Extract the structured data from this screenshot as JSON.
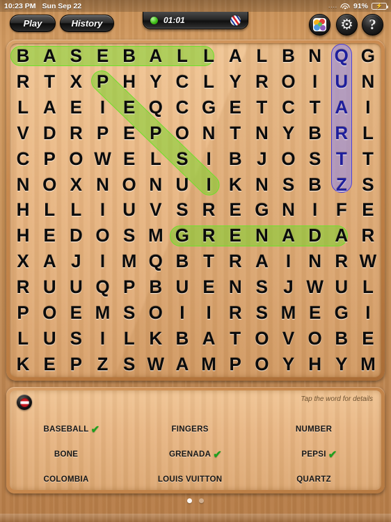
{
  "status_bar": {
    "time": "10:23 PM",
    "date": "Sun Sep 22",
    "signal_dots": "....",
    "wifi_icon": "wifi-icon",
    "battery_percent": "91%",
    "battery_icon": "battery-charging-icon"
  },
  "toolbar": {
    "play_label": "Play",
    "history_label": "History",
    "timer": "01:01",
    "timer_status_icon": "green-dot-icon",
    "timer_right_icon": "candy-stripe-icon",
    "gamecenter_icon": "game-center-icon",
    "settings_icon": "gear-icon",
    "help_icon": "question-mark-icon"
  },
  "grid": {
    "rows": 13,
    "cols": 14,
    "letters": [
      [
        "B",
        "A",
        "S",
        "E",
        "B",
        "A",
        "L",
        "L",
        "A",
        "L",
        "B",
        "N",
        "Q",
        "G"
      ],
      [
        "R",
        "T",
        "X",
        "P",
        "H",
        "Y",
        "C",
        "L",
        "Y",
        "R",
        "O",
        "I",
        "U",
        "N"
      ],
      [
        "L",
        "A",
        "E",
        "I",
        "E",
        "Q",
        "C",
        "G",
        "E",
        "T",
        "C",
        "T",
        "A",
        "I"
      ],
      [
        "V",
        "D",
        "R",
        "P",
        "E",
        "P",
        "O",
        "N",
        "T",
        "N",
        "Y",
        "B",
        "R",
        "L"
      ],
      [
        "C",
        "P",
        "O",
        "W",
        "E",
        "L",
        "S",
        "I",
        "B",
        "J",
        "O",
        "S",
        "T",
        "T"
      ],
      [
        "N",
        "O",
        "X",
        "N",
        "O",
        "N",
        "U",
        "I",
        "K",
        "N",
        "S",
        "B",
        "Z",
        "S"
      ],
      [
        "H",
        "L",
        "L",
        "I",
        "U",
        "V",
        "S",
        "R",
        "E",
        "G",
        "N",
        "I",
        "F",
        "E"
      ],
      [
        "H",
        "E",
        "D",
        "O",
        "S",
        "M",
        "G",
        "R",
        "E",
        "N",
        "A",
        "D",
        "A",
        "R"
      ],
      [
        "X",
        "A",
        "J",
        "I",
        "M",
        "Q",
        "B",
        "T",
        "R",
        "A",
        "I",
        "N",
        "R",
        "W"
      ],
      [
        "R",
        "U",
        "U",
        "Q",
        "P",
        "B",
        "U",
        "E",
        "N",
        "S",
        "J",
        "W",
        "U",
        "L"
      ],
      [
        "P",
        "O",
        "E",
        "M",
        "S",
        "O",
        "I",
        "I",
        "R",
        "S",
        "M",
        "E",
        "G",
        "I"
      ],
      [
        "L",
        "U",
        "S",
        "I",
        "L",
        "K",
        "B",
        "A",
        "T",
        "O",
        "V",
        "O",
        "B",
        "E"
      ],
      [
        "K",
        "E",
        "P",
        "Z",
        "S",
        "W",
        "A",
        "M",
        "P",
        "O",
        "Y",
        "H",
        "Y",
        "M"
      ]
    ],
    "found_words": [
      {
        "word": "BASEBALL",
        "color": "#7cd42e",
        "type": "horizontal",
        "row": 0,
        "col": 0,
        "length": 8
      },
      {
        "word": "PEPSI",
        "color": "#7cd42e",
        "type": "diagonal",
        "row": 1,
        "col": 3,
        "length": 5
      },
      {
        "word": "GRENADA",
        "color": "#7cd42e",
        "type": "horizontal",
        "row": 7,
        "col": 6,
        "length": 7
      },
      {
        "word": "QUARTZ",
        "color": "#968ce1",
        "type": "vertical",
        "row": 0,
        "col": 12,
        "length": 6
      }
    ]
  },
  "word_panel": {
    "flag_icon": "flag-button-icon",
    "hint": "Tap the word for details",
    "words": [
      {
        "label": "BASEBALL",
        "found": true
      },
      {
        "label": "FINGERS",
        "found": false
      },
      {
        "label": "NUMBER",
        "found": false
      },
      {
        "label": "BONE",
        "found": false
      },
      {
        "label": "GRENADA",
        "found": true
      },
      {
        "label": "PEPSI",
        "found": true
      },
      {
        "label": "COLOMBIA",
        "found": false
      },
      {
        "label": "LOUIS VUITTON",
        "found": false
      },
      {
        "label": "QUARTZ",
        "found": false
      }
    ],
    "check_glyph": "✔"
  },
  "pagination": {
    "total": 2,
    "active": 0
  },
  "colors": {
    "highlight_green": "#7cd42e",
    "highlight_purple": "#968ce1",
    "wood_light": "#eab884",
    "wood_dark": "#b67a42"
  }
}
